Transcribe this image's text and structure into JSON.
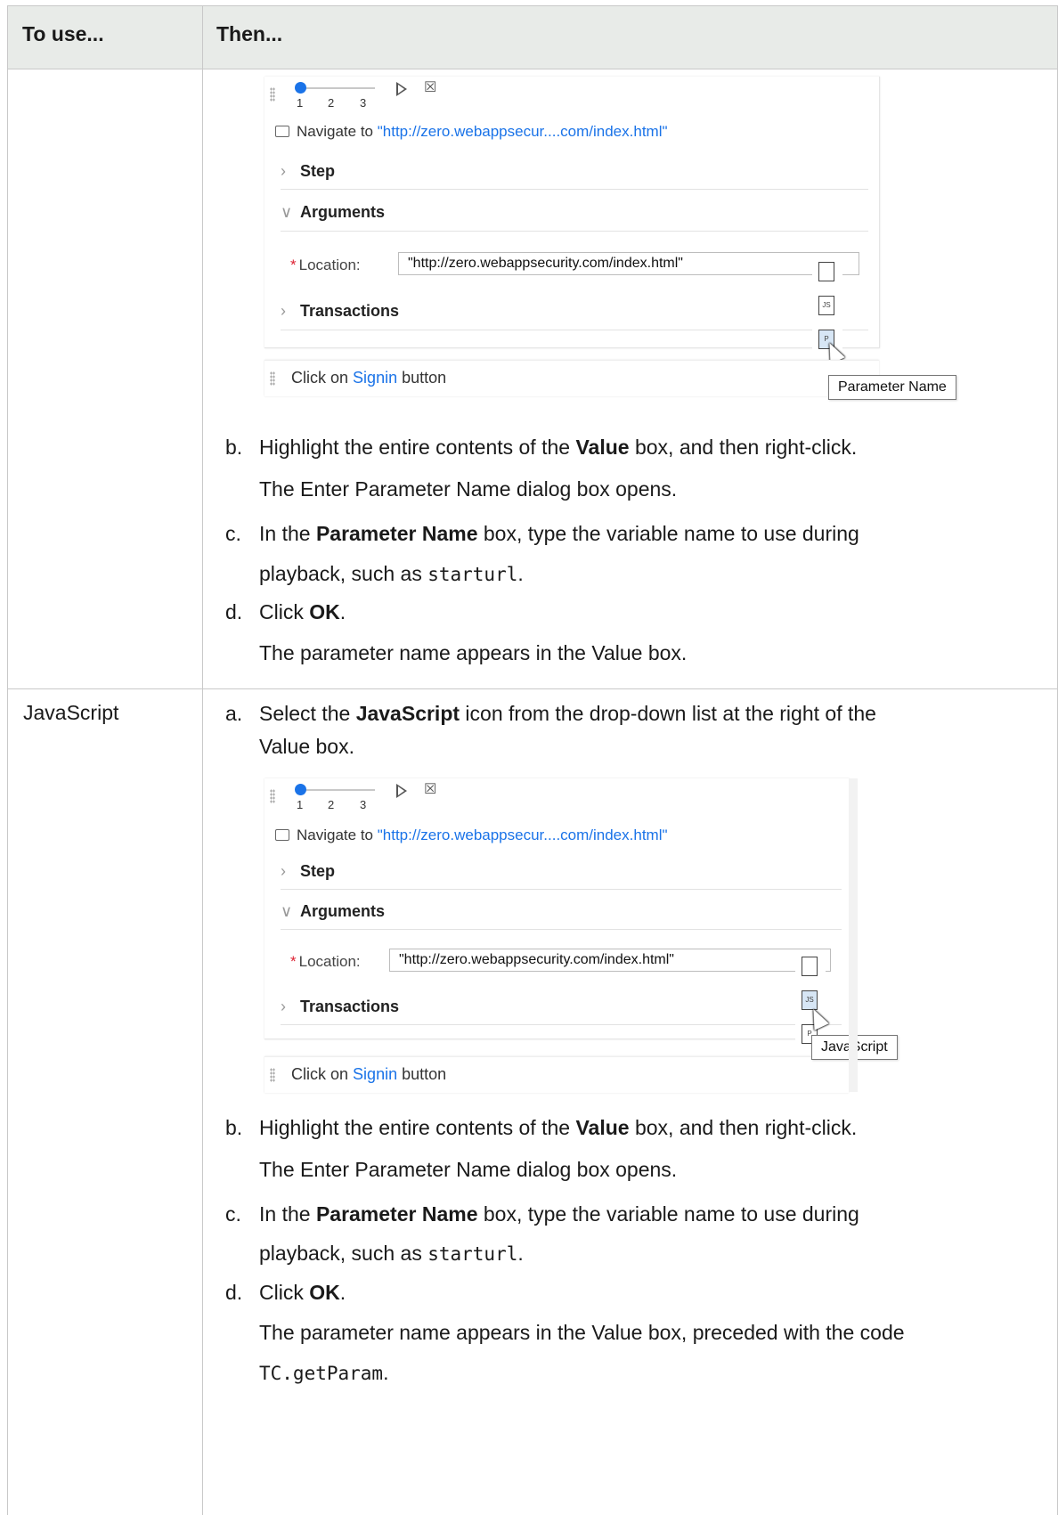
{
  "table": {
    "col1_header": "To use...",
    "col2_header": "Then..."
  },
  "widget": {
    "ticks": [
      "1",
      "2",
      "3"
    ],
    "navigate_prefix": "Navigate to",
    "navigate_url": "\"http://zero.webappsecur....com/index.html\"",
    "section_step": "Step",
    "section_arguments": "Arguments",
    "location_required": "*",
    "location_label": "Location:",
    "location_value": "\"http://zero.webappsecurity.com/index.html\"",
    "section_transactions": "Transactions",
    "click_prefix": "Click on",
    "click_link": "Signin",
    "click_suffix": "button",
    "icon_labels": [
      "",
      "JS",
      "P"
    ]
  },
  "row1": {
    "tooltip": "Parameter Name",
    "b_letter": "b.",
    "b_pre": "Highlight the entire contents of the ",
    "b_bold": "Value",
    "b_post": " box, and then right-click.",
    "b_sub": "The Enter Parameter Name dialog box opens.",
    "c_letter": "c.",
    "c_pre": "In the ",
    "c_bold": "Parameter Name",
    "c_post": " box, type the variable name to use during",
    "c_line2_pre": "playback, such as ",
    "c_code": "starturl",
    "c_line2_post": ".",
    "d_letter": "d.",
    "d_pre": "Click ",
    "d_bold": "OK",
    "d_post": ".",
    "d_sub": "The parameter name appears in the Value box."
  },
  "row2": {
    "label": "JavaScript",
    "a_letter": "a.",
    "a_pre": "Select the ",
    "a_bold": "JavaScript",
    "a_post": " icon from the drop-down list at the right of the",
    "a_line2": "Value box.",
    "tooltip": "JavaScript",
    "b_letter": "b.",
    "b_pre": "Highlight the entire contents of the ",
    "b_bold": "Value",
    "b_post": " box, and then right-click.",
    "b_sub": "The Enter Parameter Name dialog box opens.",
    "c_letter": "c.",
    "c_pre": "In the ",
    "c_bold": "Parameter Name",
    "c_post": " box, type the variable name to use during",
    "c_line2_pre": "playback, such as ",
    "c_code": "starturl",
    "c_line2_post": ".",
    "d_letter": "d.",
    "d_pre": "Click ",
    "d_bold": "OK",
    "d_post": ".",
    "d_sub": "The parameter name appears in the Value box, preceded with the code",
    "d_code": "TC.getParam",
    "d_code_post": "."
  }
}
